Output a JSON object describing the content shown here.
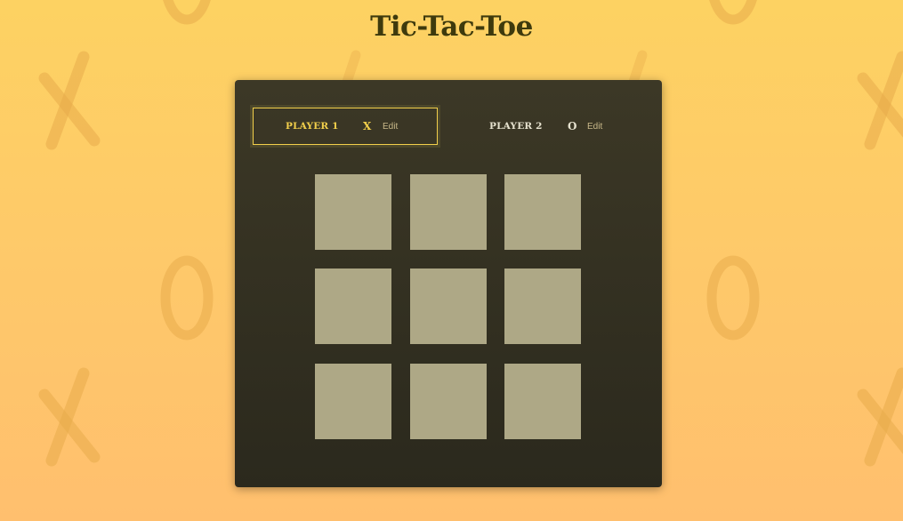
{
  "page": {
    "title": "Tic-Tac-Toe"
  },
  "colors": {
    "background_top": "#fdd262",
    "background_bottom": "#ffbf6e",
    "board_bg": "#34311f",
    "cell": "#aea886",
    "active_player": "#f2cf4b",
    "inactive_player": "#e6e2cf",
    "title": "#3e3a0d"
  },
  "players": [
    {
      "name": "PLAYER 1",
      "symbol": "X",
      "edit_label": "Edit",
      "active": true
    },
    {
      "name": "PLAYER 2",
      "symbol": "O",
      "edit_label": "Edit",
      "active": false
    }
  ],
  "board": {
    "cells": [
      "",
      "",
      "",
      "",
      "",
      "",
      "",
      "",
      ""
    ]
  },
  "background_icons": [
    "x-icon",
    "o-icon"
  ]
}
